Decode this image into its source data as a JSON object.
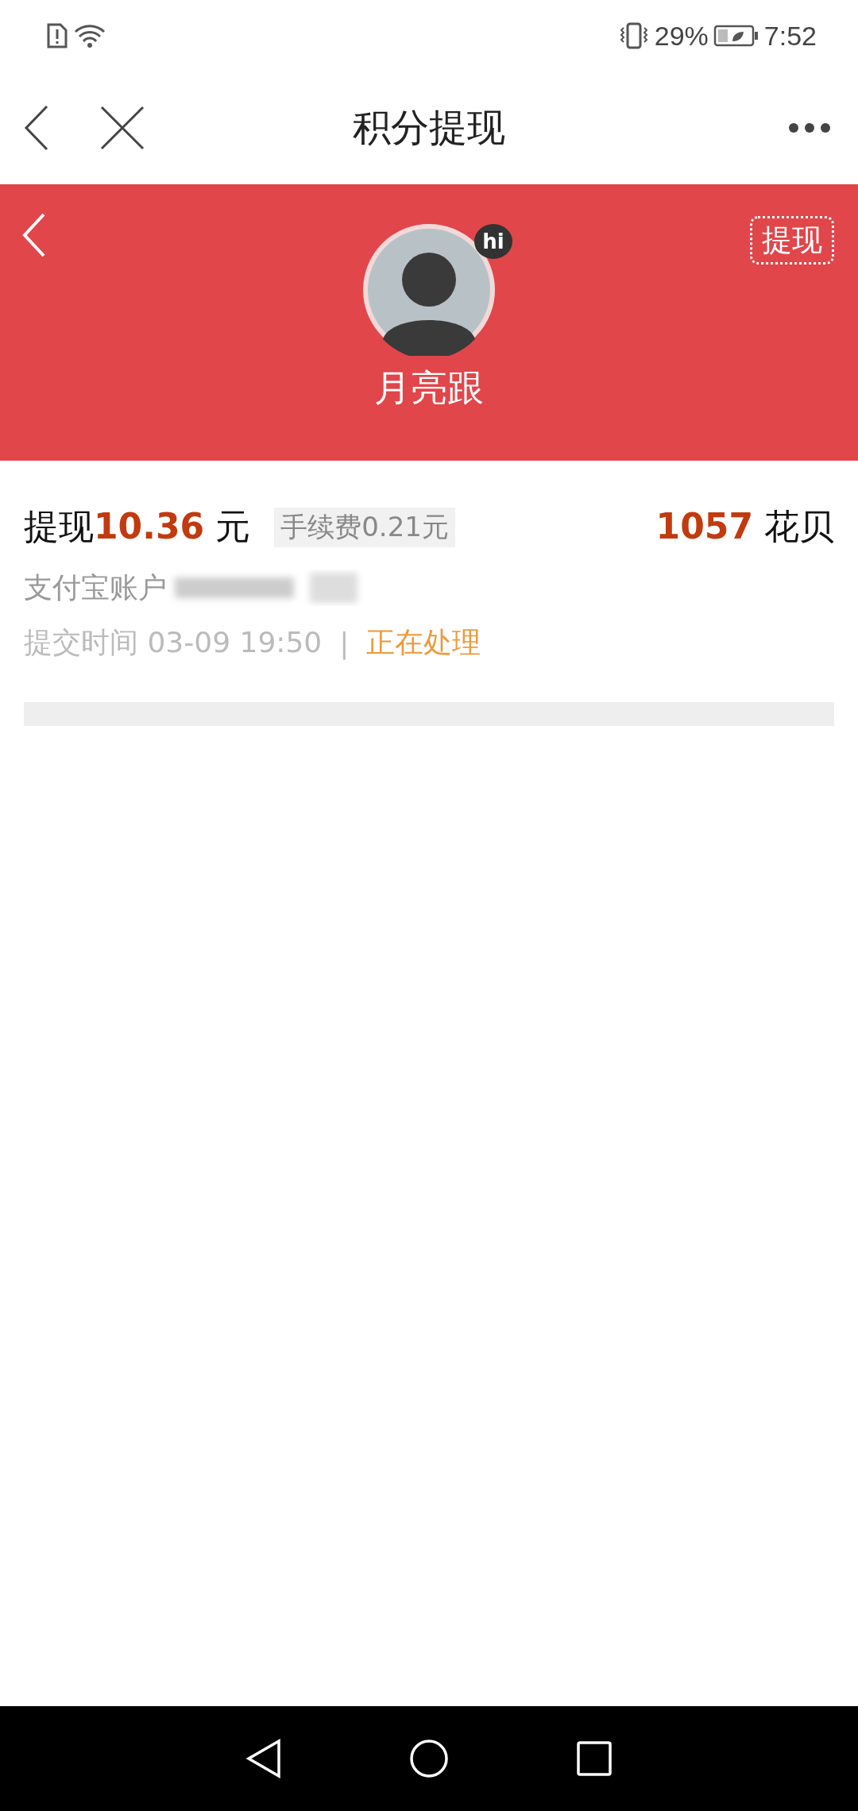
{
  "status_bar": {
    "battery": "29%",
    "time": "7:52"
  },
  "nav": {
    "title": "积分提现"
  },
  "header": {
    "badge": "hi",
    "name": "月亮跟",
    "action": "提现"
  },
  "records": [
    {
      "label": "提现",
      "amount": "10.36",
      "unit": "元",
      "fee": "手续费0.21元",
      "points": "1057",
      "points_unit": "花贝",
      "account": "支付宝账户",
      "time": "提交时间 03-09 19:50",
      "separator": "|",
      "status": "正在处理"
    }
  ]
}
